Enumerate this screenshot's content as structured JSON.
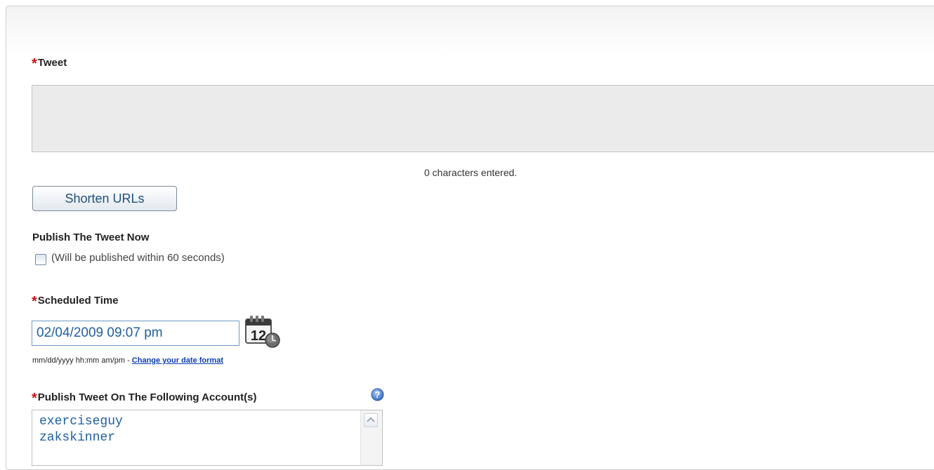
{
  "tweet": {
    "label": "Tweet",
    "required_mark": "*",
    "value": "",
    "char_count_text": "0 characters entered."
  },
  "shorten_button": {
    "label": "Shorten URLs"
  },
  "publish_now": {
    "label": "Publish The Tweet Now",
    "checkbox_label": "(Will be published within 60 seconds)",
    "checked": false
  },
  "scheduled": {
    "label": "Scheduled Time",
    "required_mark": "*",
    "value": "02/04/2009 09:07 pm",
    "calendar_day": "12",
    "format_hint": "mm/dd/yyyy hh:mm am/pm - ",
    "change_format_link": "Change your date format"
  },
  "accounts": {
    "label": "Publish Tweet On The Following Account(s)",
    "required_mark": "*",
    "items": [
      "exerciseguy",
      "zakskinner"
    ]
  },
  "colors": {
    "required": "#cc1111",
    "link": "#0a3cb3",
    "input_text": "#1f5fa0"
  }
}
